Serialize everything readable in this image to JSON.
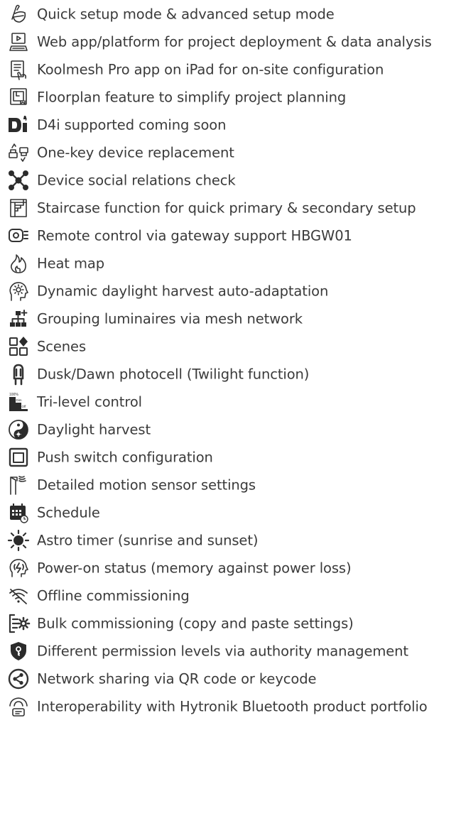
{
  "features": [
    {
      "icon": "setup-mode-icon",
      "label": "Quick setup mode & advanced setup mode"
    },
    {
      "icon": "web-platform-icon",
      "label": "Web app/platform for project deployment & data analysis"
    },
    {
      "icon": "ipad-app-icon",
      "label": "Koolmesh Pro app on iPad for on-site configuration"
    },
    {
      "icon": "floorplan-icon",
      "label": "Floorplan feature to simplify project planning"
    },
    {
      "icon": "d4i-icon",
      "label": "D4i supported coming soon"
    },
    {
      "icon": "device-replacement-icon",
      "label": "One-key device replacement"
    },
    {
      "icon": "social-relations-icon",
      "label": "Device social relations check"
    },
    {
      "icon": "staircase-icon",
      "label": "Staircase function for quick primary & secondary setup"
    },
    {
      "icon": "gateway-icon",
      "label": "Remote control via gateway support HBGW01"
    },
    {
      "icon": "heat-map-icon",
      "label": "Heat map"
    },
    {
      "icon": "daylight-adaptation-icon",
      "label": "Dynamic daylight harvest auto-adaptation"
    },
    {
      "icon": "grouping-icon",
      "label": "Grouping luminaires via mesh network"
    },
    {
      "icon": "scenes-icon",
      "label": "Scenes"
    },
    {
      "icon": "photocell-icon",
      "label": "Dusk/Dawn photocell (Twilight function)"
    },
    {
      "icon": "tri-level-icon",
      "label": "Tri-level control",
      "icon_text": [
        "100%",
        "Dim",
        "Off"
      ]
    },
    {
      "icon": "daylight-harvest-icon",
      "label": "Daylight harvest"
    },
    {
      "icon": "push-switch-icon",
      "label": "Push switch configuration"
    },
    {
      "icon": "motion-sensor-icon",
      "label": "Detailed motion sensor settings"
    },
    {
      "icon": "schedule-icon",
      "label": "Schedule"
    },
    {
      "icon": "sun-icon",
      "label": "Astro timer (sunrise and sunset)"
    },
    {
      "icon": "power-on-icon",
      "label": "Power-on status (memory against power loss)"
    },
    {
      "icon": "offline-icon",
      "label": "Offline commissioning"
    },
    {
      "icon": "bulk-commissioning-icon",
      "label": "Bulk commissioning (copy and paste settings)"
    },
    {
      "icon": "permission-shield-icon",
      "label": "Different permission levels via authority management"
    },
    {
      "icon": "share-icon",
      "label": "Network sharing via QR code or keycode"
    },
    {
      "icon": "interoperability-icon",
      "label": "Interoperability with Hytronik Bluetooth product portfolio"
    }
  ]
}
